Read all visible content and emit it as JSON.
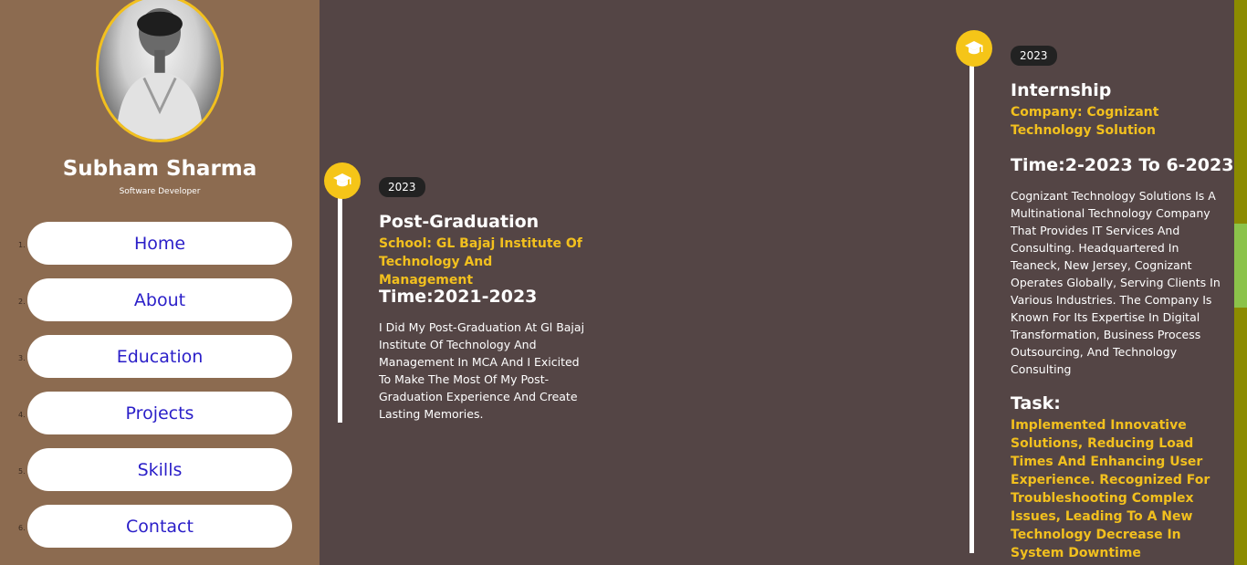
{
  "profile": {
    "name": "Subham Sharma",
    "role": "Software Developer"
  },
  "nav": {
    "items": [
      {
        "num": "1.",
        "label": "Home"
      },
      {
        "num": "2.",
        "label": "About"
      },
      {
        "num": "3.",
        "label": "Education"
      },
      {
        "num": "4.",
        "label": "Projects"
      },
      {
        "num": "5.",
        "label": "Skills"
      },
      {
        "num": "6.",
        "label": "Contact"
      }
    ]
  },
  "education": {
    "year": "2023",
    "title": "Post-Graduation",
    "school": "School: GL Bajaj Institute Of Technology And Management",
    "time": "Time:2021-2023",
    "description": "I Did My Post-Graduation At Gl Bajaj Institute Of Technology And Management In MCA And I Exicited To Make The Most Of My Post-Graduation Experience And Create Lasting Memories."
  },
  "internship": {
    "year": "2023",
    "title": "Internship",
    "company": "Company: Cognizant Technology Solution",
    "time": "Time:2-2023 To 6-2023",
    "description": "Cognizant Technology Solutions Is A Multinational Technology Company That Provides IT Services And Consulting. Headquartered In Teaneck, New Jersey, Cognizant Operates Globally, Serving Clients In Various Industries. The Company Is Known For Its Expertise In Digital Transformation, Business Process Outsourcing, And Technology Consulting",
    "task_heading": "Task:",
    "task": "Implemented Innovative Solutions, Reducing Load Times And Enhancing User Experience. Recognized For Troubleshooting Complex Issues, Leading To A New Technology Decrease In System Downtime"
  },
  "colors": {
    "sidebar": "#8c6b50",
    "main": "#544545",
    "accent": "#f5c518",
    "nav_text": "#2a1ec8"
  },
  "icons": {
    "timeline": "graduation-cap-icon"
  }
}
